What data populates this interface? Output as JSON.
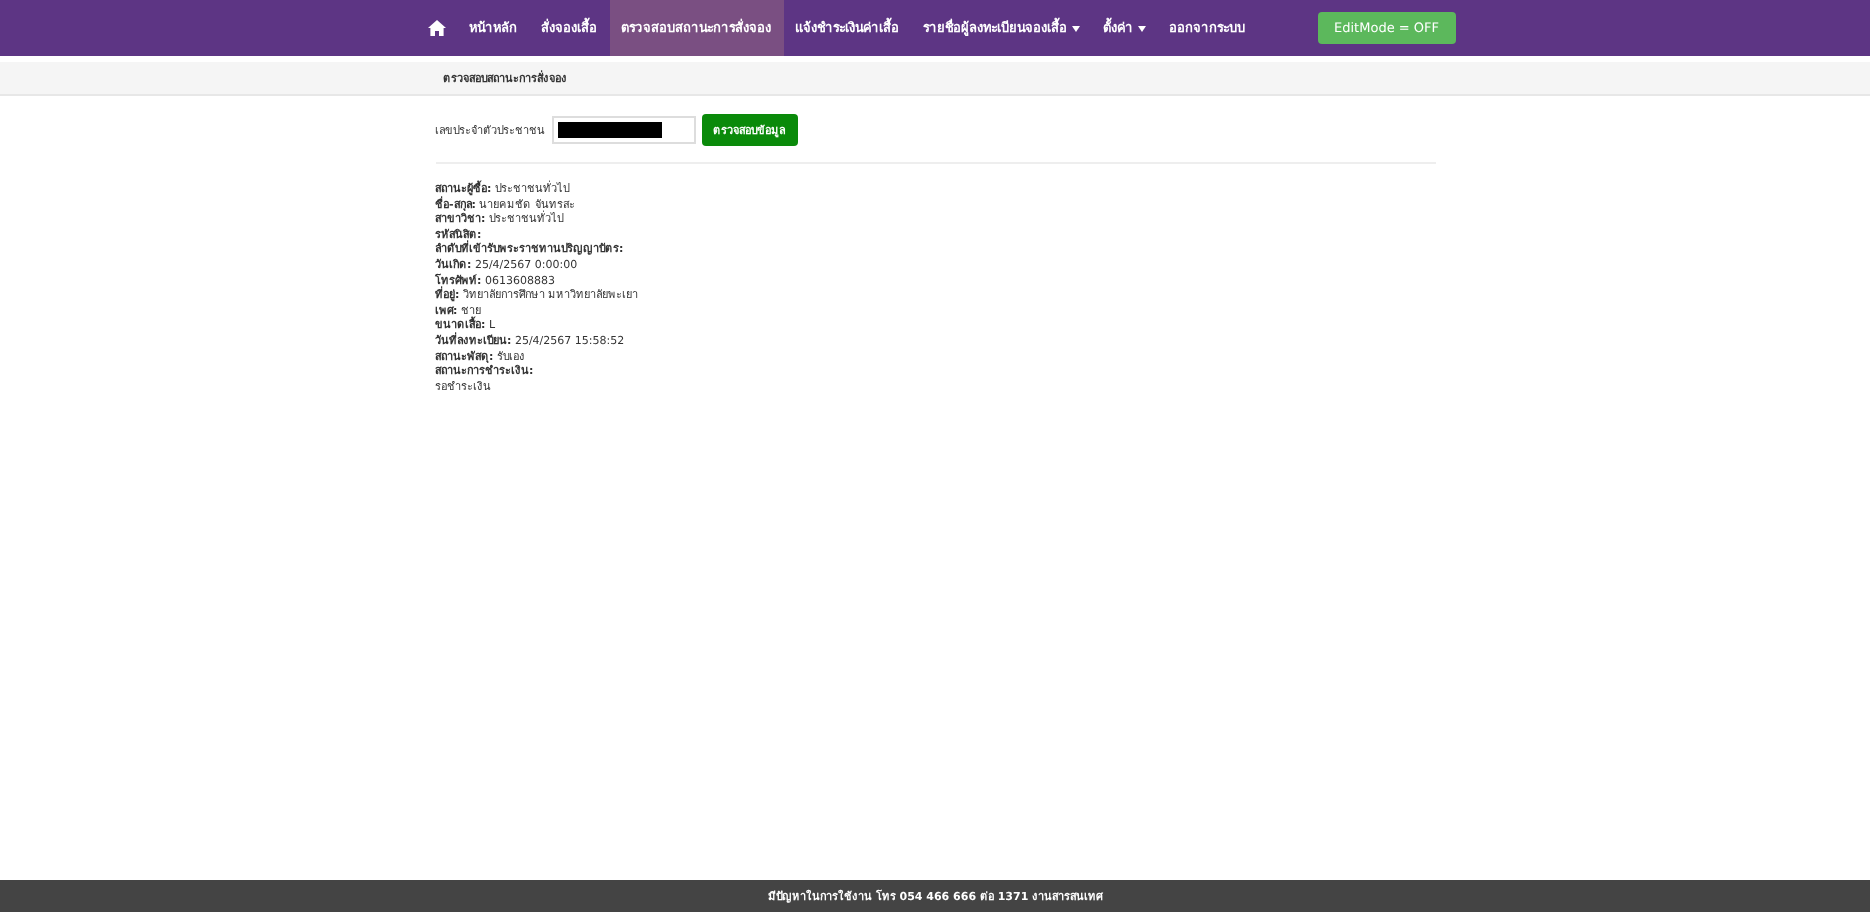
{
  "navbar": {
    "items": [
      {
        "kind": "home",
        "selected": false,
        "dropdown": false
      },
      {
        "kind": "link",
        "label": "หน้าหลัก",
        "selected": false,
        "dropdown": false
      },
      {
        "kind": "link",
        "label": "สั่งจองเสื้อ",
        "selected": false,
        "dropdown": false
      },
      {
        "kind": "link",
        "label": "ตรวจสอบสถานะการสั่งจอง",
        "selected": true,
        "dropdown": false
      },
      {
        "kind": "link",
        "label": "แจ้งชำระเงินค่าเสื้อ",
        "selected": false,
        "dropdown": false
      },
      {
        "kind": "link",
        "label": "รายชื่อผู้ลงทะเบียนจองเสื้อ",
        "selected": false,
        "dropdown": true
      },
      {
        "kind": "link",
        "label": "ตั้งค่า",
        "selected": false,
        "dropdown": true
      },
      {
        "kind": "link",
        "label": "ออกจากระบบ",
        "selected": false,
        "dropdown": false
      }
    ],
    "edit_mode_button": "EditMode = OFF"
  },
  "breadcrumb": "ตรวจสอบสถานะการสั่งจอง",
  "search": {
    "label": "เลขประจำตัวประชาชน",
    "redacted": true,
    "button": "ตรวจสอบข้อมูล"
  },
  "details": [
    {
      "label": "สถานะผู้ซื้อ:",
      "value": "ประชาชนทั่วไป"
    },
    {
      "label": "ชื่อ-สกุล:",
      "value": "นายคมชัด จันทรสะ"
    },
    {
      "label": "สาขาวิชา:",
      "value": "ประชาชนทั่วไป"
    },
    {
      "label": "รหัสนิสิต:"
    },
    {
      "label": "ลำดับที่เข้ารับพระราชทานปริญญาบัตร:"
    },
    {
      "label": "วันเกิด:",
      "value": "25/4/2567 0:00:00"
    },
    {
      "label": "โทรศัพท์:",
      "value": "0613608883"
    },
    {
      "label": "ที่อยู่:",
      "value": "วิทยาลัยการศึกษา มหาวิทยาลัยพะเยา"
    },
    {
      "label": "เพศ:",
      "value": "ชาย"
    },
    {
      "label": "ขนาดเสื้อ:",
      "value": "L"
    },
    {
      "label": "วันที่ลงทะเบียน:",
      "value": "25/4/2567 15:58:52"
    },
    {
      "label": "สถานะพัสดุ:",
      "value": "รับเอง"
    },
    {
      "label": "สถานะการชำระเงิน:"
    }
  ],
  "payment_status": "รอชำระเงิน",
  "footer": "มีปัญหาในการใช้งาน โทร 054 466 666 ต่อ 1371 งานสารสนเทศ"
}
